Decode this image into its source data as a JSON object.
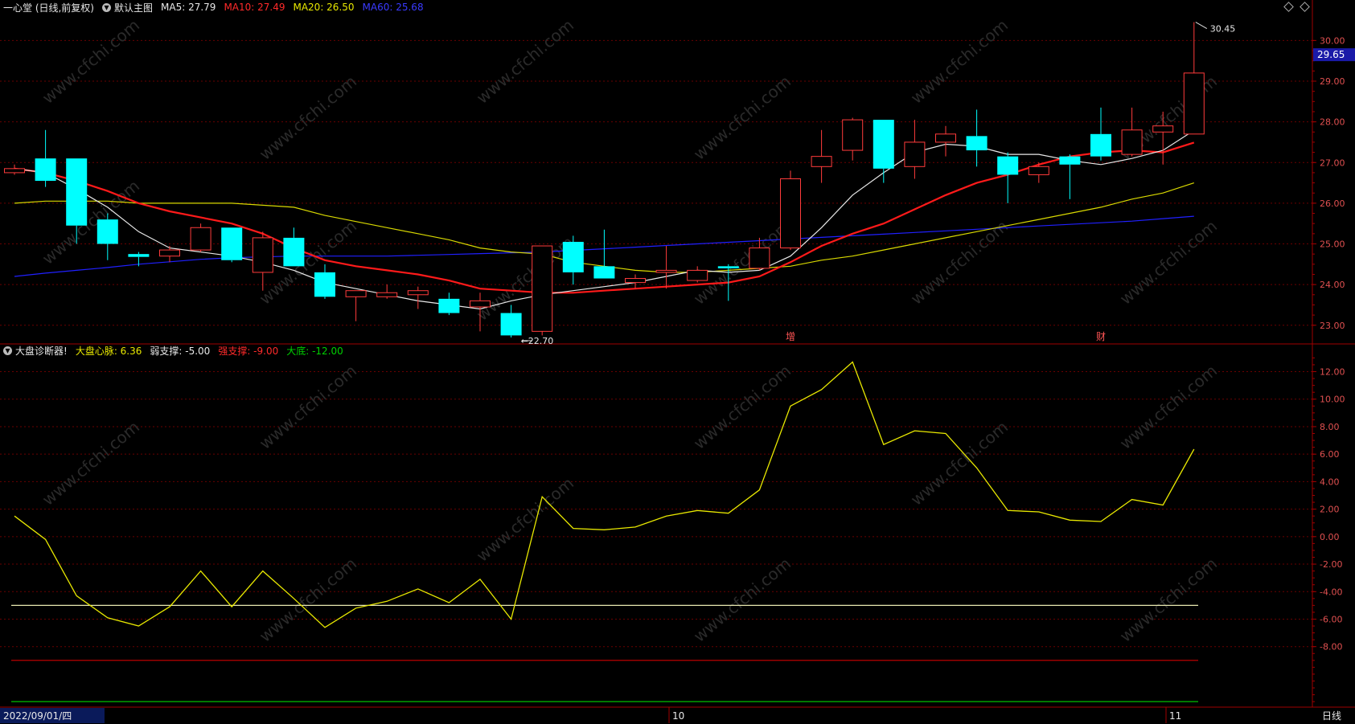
{
  "header": {
    "security": "一心堂 (日线,前复权)",
    "overlay_label": "默认主图",
    "ma5": "MA5: 27.79",
    "ma10": "MA10: 27.49",
    "ma20": "MA20: 26.50",
    "ma60": "MA60: 25.68"
  },
  "indicator_header": {
    "name": "大盘诊断器!",
    "pulse": "大盘心脉: 6.36",
    "weak": "弱支撑: -5.00",
    "strong": "强支撑: -9.00",
    "bottom": "大底: -12.00"
  },
  "colors": {
    "up": "#ff3b3b",
    "down": "#00ffff",
    "ma5": "#e8e8e8",
    "ma10": "#ff1a1a",
    "ma20": "#d8d800",
    "ma60": "#2020ff",
    "grid": "#6a0000",
    "axis": "#a00000",
    "pulse": "#e8e800",
    "weak": "#e8e8b0",
    "strong": "#d00000",
    "bottom": "#00c000"
  },
  "chart_data": [
    {
      "type": "candlestick",
      "yrange": [
        22.6,
        30.6
      ],
      "ticks": [
        23.0,
        24.0,
        25.0,
        26.0,
        27.0,
        28.0,
        29.0,
        30.0
      ],
      "tick_labels": [
        "23.00",
        "24.00",
        "25.00",
        "26.00",
        "27.00",
        "28.00",
        "29.00",
        "30.00"
      ],
      "current_price": "29.65",
      "high_label": "30.45",
      "low_label": "22.70",
      "ohlc": [
        [
          26.75,
          26.95,
          26.7,
          26.85
        ],
        [
          27.1,
          27.8,
          26.4,
          26.55
        ],
        [
          27.1,
          27.1,
          25.0,
          25.45
        ],
        [
          25.6,
          25.75,
          24.6,
          25.0
        ],
        [
          24.75,
          24.8,
          24.45,
          24.68
        ],
        [
          24.7,
          24.95,
          24.55,
          24.85
        ],
        [
          24.85,
          25.5,
          24.8,
          25.4
        ],
        [
          25.4,
          25.4,
          24.55,
          24.6
        ],
        [
          24.3,
          25.3,
          23.85,
          25.15
        ],
        [
          25.15,
          25.4,
          24.45,
          24.45
        ],
        [
          24.3,
          24.5,
          23.65,
          23.7
        ],
        [
          23.7,
          23.85,
          23.1,
          23.85
        ],
        [
          23.7,
          24.0,
          23.65,
          23.8
        ],
        [
          23.75,
          23.95,
          23.4,
          23.85
        ],
        [
          23.65,
          23.8,
          23.25,
          23.3
        ],
        [
          23.45,
          23.8,
          22.85,
          23.6
        ],
        [
          23.3,
          23.5,
          22.7,
          22.75
        ],
        [
          22.85,
          24.95,
          22.75,
          24.95
        ],
        [
          25.05,
          25.2,
          24.0,
          24.3
        ],
        [
          24.45,
          25.35,
          24.15,
          24.15
        ],
        [
          24.05,
          24.25,
          23.9,
          24.15
        ],
        [
          24.3,
          24.95,
          23.9,
          24.35
        ],
        [
          24.1,
          24.45,
          24.05,
          24.35
        ],
        [
          24.45,
          24.5,
          23.6,
          24.4
        ],
        [
          24.4,
          25.15,
          24.35,
          24.9
        ],
        [
          24.9,
          26.8,
          24.85,
          26.6
        ],
        [
          26.9,
          27.8,
          26.5,
          27.15
        ],
        [
          27.3,
          28.1,
          27.05,
          28.05
        ],
        [
          28.05,
          28.05,
          26.5,
          26.85
        ],
        [
          26.9,
          28.05,
          26.6,
          27.5
        ],
        [
          27.5,
          27.9,
          27.15,
          27.7
        ],
        [
          27.65,
          28.3,
          26.9,
          27.3
        ],
        [
          27.15,
          27.25,
          26.0,
          26.7
        ],
        [
          26.7,
          27.0,
          26.5,
          26.9
        ],
        [
          27.15,
          27.2,
          26.1,
          26.95
        ],
        [
          27.7,
          28.35,
          27.05,
          27.15
        ],
        [
          27.2,
          28.35,
          27.15,
          27.8
        ],
        [
          27.75,
          28.25,
          26.95,
          27.9
        ],
        [
          27.7,
          30.45,
          27.7,
          29.2
        ]
      ],
      "ma5": [
        26.85,
        26.75,
        26.35,
        25.9,
        25.3,
        24.9,
        24.8,
        24.7,
        24.55,
        24.35,
        24.05,
        23.9,
        23.75,
        23.6,
        23.5,
        23.4,
        23.6,
        23.75,
        23.85,
        23.95,
        24.05,
        24.2,
        24.35,
        24.3,
        24.35,
        24.7,
        25.4,
        26.2,
        26.75,
        27.25,
        27.45,
        27.4,
        27.2,
        27.2,
        27.05,
        26.95,
        27.1,
        27.3,
        27.79
      ],
      "ma10": [
        26.85,
        26.75,
        26.55,
        26.3,
        26.0,
        25.8,
        25.65,
        25.5,
        25.25,
        24.9,
        24.6,
        24.45,
        24.35,
        24.25,
        24.1,
        23.9,
        23.85,
        23.8,
        23.8,
        23.85,
        23.9,
        23.95,
        24.0,
        24.05,
        24.2,
        24.55,
        24.95,
        25.25,
        25.5,
        25.85,
        26.2,
        26.5,
        26.7,
        26.95,
        27.15,
        27.25,
        27.3,
        27.25,
        27.49
      ],
      "ma20": [
        26.0,
        26.05,
        26.05,
        26.05,
        26.0,
        26.0,
        26.0,
        26.0,
        25.95,
        25.9,
        25.7,
        25.55,
        25.4,
        25.25,
        25.1,
        24.9,
        24.8,
        24.75,
        24.55,
        24.45,
        24.35,
        24.3,
        24.3,
        24.35,
        24.4,
        24.45,
        24.6,
        24.7,
        24.85,
        25.0,
        25.15,
        25.3,
        25.45,
        25.6,
        25.75,
        25.9,
        26.1,
        26.25,
        26.5
      ],
      "ma60": [
        24.2,
        24.28,
        24.35,
        24.42,
        24.5,
        24.56,
        24.62,
        24.66,
        24.68,
        24.7,
        24.7,
        24.7,
        24.7,
        24.72,
        24.74,
        24.76,
        24.78,
        24.8,
        24.84,
        24.88,
        24.92,
        24.96,
        25.0,
        25.04,
        25.08,
        25.12,
        25.16,
        25.2,
        25.24,
        25.28,
        25.32,
        25.36,
        25.4,
        25.44,
        25.48,
        25.52,
        25.56,
        25.62,
        25.68
      ],
      "markers": [
        {
          "text": "增",
          "index": 25
        },
        {
          "text": "财",
          "index": 35
        }
      ]
    },
    {
      "type": "line",
      "name": "大盘心脉",
      "yrange": [
        -12.4,
        13.9
      ],
      "ticks": [
        -8,
        -6,
        -4,
        -2,
        0,
        2,
        4,
        6,
        8,
        10,
        12
      ],
      "tick_labels": [
        "-8.00",
        "-6.00",
        "-4.00",
        "-2.00",
        "0.00",
        "2.00",
        "4.00",
        "6.00",
        "8.00",
        "10.00",
        "12.00"
      ],
      "values": [
        1.5,
        -0.2,
        -4.3,
        -5.9,
        -6.5,
        -5.1,
        -2.5,
        -5.1,
        -2.5,
        -4.5,
        -6.6,
        -5.2,
        -4.7,
        -3.8,
        -4.8,
        -3.1,
        -6.0,
        2.9,
        0.6,
        0.5,
        0.7,
        1.5,
        1.9,
        1.7,
        3.4,
        9.5,
        10.7,
        12.7,
        6.7,
        7.7,
        7.5,
        5.0,
        1.9,
        1.8,
        1.2,
        1.1,
        2.7,
        2.3,
        6.36
      ],
      "levels": [
        {
          "name": "弱支撑",
          "value": -5.0
        },
        {
          "name": "强支撑",
          "value": -9.0
        },
        {
          "name": "大底",
          "value": -12.0
        }
      ]
    }
  ],
  "footer": {
    "date": "2022/09/01/四",
    "month_oct": "10",
    "month_nov": "11",
    "period": "日线"
  },
  "watermark": "www.cfchi.com"
}
